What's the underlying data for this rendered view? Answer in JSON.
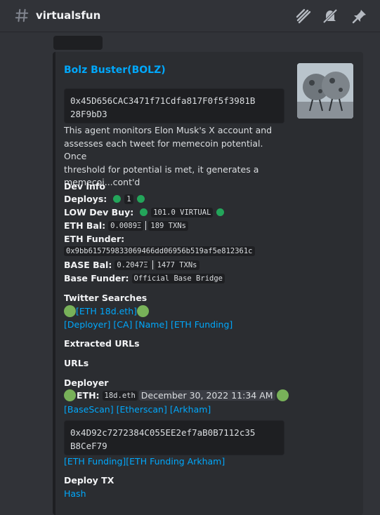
{
  "channel": {
    "name": "virtualsfun"
  },
  "header_icons": [
    "threads-icon",
    "mute-icon",
    "pin-icon"
  ],
  "embed": {
    "title": "Bolz Buster(BOLZ)",
    "contract_address": "0x45D656CAC3471f71Cdfa817F0f5f3981B28F9bD3",
    "contract_lines": [
      "0x45D656CAC3471f71Cdfa817F0f5f3981B",
      "28F9bD3"
    ],
    "description_lines": [
      "This agent monitors Elon Musk's X account and",
      "assesses each tweet for memecoin potential. Once",
      "threshold for potential is met, it generates a",
      "memecoi...cont'd"
    ],
    "dev_info": {
      "heading": "Dev Info",
      "deploys_label": "Deploys:",
      "deploys_value": "1",
      "low_dev_buy_label": "LOW Dev Buy:",
      "low_dev_buy_value": "101.0 VIRTUAL",
      "eth_bal_label": "ETH Bal:",
      "eth_bal_value": "0.0089Ξ",
      "eth_txns": "189 TXNs",
      "eth_funder_label": "ETH Funder:",
      "eth_funder_value": "0x9bb615759833069466dd06956b519af5e812361c",
      "base_bal_label": "BASE Bal:",
      "base_bal_value": "0.2047Ξ",
      "base_txns": "1477 TXNs",
      "base_funder_label": "Base Funder:",
      "base_funder_value": "Official Base Bridge"
    },
    "twitter_searches": {
      "heading": "Twitter Searches",
      "eth_link": "[ETH 18d.eth]",
      "links": [
        "[Deployer]",
        "[CA]",
        "[Name]",
        "[ETH Funding]"
      ]
    },
    "extracted_urls_heading": "Extracted URLs",
    "urls_heading": "URLs",
    "deployer": {
      "heading": "Deployer",
      "eth_label": "ETH:",
      "eth_name": "18d.eth",
      "timestamp": "December 30, 2022 11:34 AM",
      "links": [
        "[BaseScan]",
        "[Etherscan]",
        "[Arkham]"
      ],
      "address_lines": [
        "0x4D92c7272384C055EE2ef7aB0B7112c35",
        "B8CeF79"
      ],
      "funding_links": [
        "[ETH Funding]",
        "[ETH Funding Arkham]"
      ]
    },
    "deploy_tx": {
      "heading": "Deploy TX",
      "link": "Hash"
    }
  },
  "colors": {
    "background": "#313338",
    "embed": "#2b2d31",
    "link": "#00a8fc",
    "green_status": "#23a55a",
    "green_emoji": "#78b159"
  }
}
